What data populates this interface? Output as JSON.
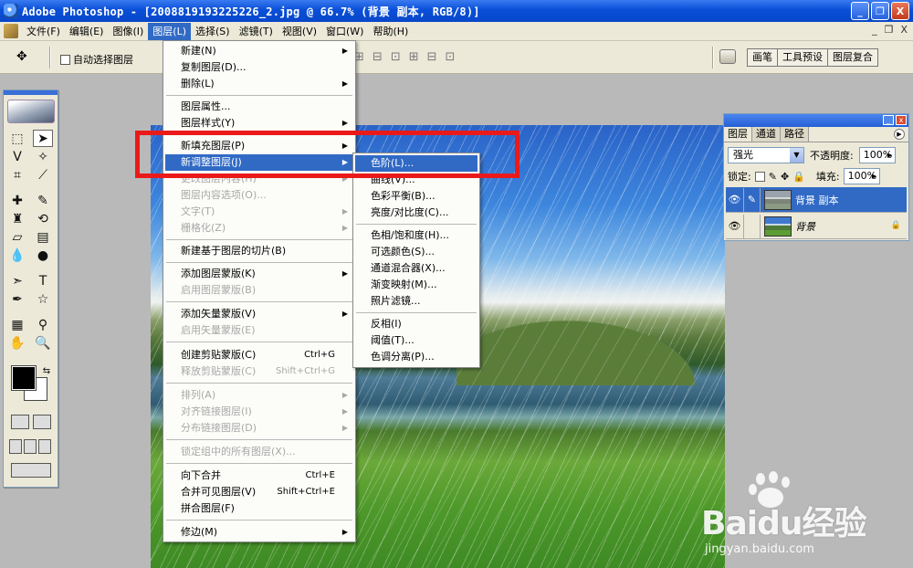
{
  "window": {
    "title": "Adobe Photoshop - [2008819193225226_2.jpg @ 66.7% (背景 副本, RGB/8)]",
    "buttons": [
      "_",
      "❐",
      "X"
    ]
  },
  "menubar": {
    "items": [
      "文件(F)",
      "编辑(E)",
      "图像(I)",
      "图层(L)",
      "选择(S)",
      "滤镜(T)",
      "视图(V)",
      "窗口(W)",
      "帮助(H)"
    ],
    "active_index": 3,
    "doc_controls": [
      "_",
      "❐",
      "X"
    ]
  },
  "options": {
    "auto_select_label": "自动选择图层",
    "panel_tabs": [
      "画笔",
      "工具预设",
      "图层复合"
    ]
  },
  "layer_menu": {
    "new": "新建(N)",
    "duplicate": "复制图层(D)...",
    "delete": "删除(L)",
    "properties": "图层属性...",
    "style": "图层样式(Y)",
    "new_fill": "新填充图层(P)",
    "new_adjustment": "新调整图层(J)",
    "change_content": "更改图层内容(H)",
    "content_options": "图层内容选项(O)...",
    "type": "文字(T)",
    "rasterize": "栅格化(Z)",
    "new_slice": "新建基于图层的切片(B)",
    "add_mask": "添加图层蒙版(K)",
    "enable_mask": "启用图层蒙版(B)",
    "add_vector_mask": "添加矢量蒙版(V)",
    "enable_vector_mask": "启用矢量蒙版(E)",
    "create_clipping": "创建剪贴蒙版(C)",
    "create_clipping_sc": "Ctrl+G",
    "release_clipping": "释放剪贴蒙版(C)",
    "release_clipping_sc": "Shift+Ctrl+G",
    "arrange": "排列(A)",
    "align": "对齐链接图层(I)",
    "distribute": "分布链接图层(D)",
    "lock_all": "锁定组中的所有图层(X)...",
    "merge_down": "向下合并",
    "merge_down_sc": "Ctrl+E",
    "merge_visible": "合并可见图层(V)",
    "merge_visible_sc": "Shift+Ctrl+E",
    "flatten": "拼合图层(F)",
    "matting": "修边(M)"
  },
  "adjust_submenu": {
    "items": [
      "色阶(L)...",
      "曲线(V)...",
      "色彩平衡(B)...",
      "亮度/对比度(C)...",
      "色相/饱和度(H)...",
      "可选颜色(S)...",
      "通道混合器(X)...",
      "渐变映射(M)...",
      "照片滤镜...",
      "反相(I)",
      "阈值(T)...",
      "色调分离(P)..."
    ]
  },
  "layers_panel": {
    "tabs": [
      "图层",
      "通道",
      "路径"
    ],
    "blend_mode": "强光",
    "opacity_label": "不透明度:",
    "opacity_value": "100%",
    "lock_label": "锁定:",
    "fill_label": "填充:",
    "fill_value": "100%",
    "layers": [
      {
        "name": "背景 副本",
        "selected": true
      },
      {
        "name": "背景",
        "selected": false
      }
    ]
  },
  "watermark": {
    "text": "Baidu经验",
    "url": "jingyan.baidu.com"
  },
  "colors": {
    "highlight": "#316ac5",
    "annotation_red": "#ea1a1a"
  }
}
